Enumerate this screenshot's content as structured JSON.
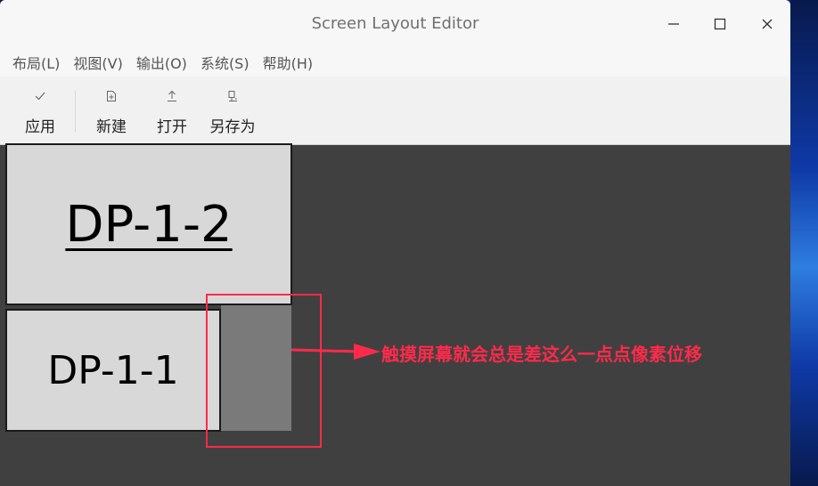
{
  "window": {
    "title": "Screen Layout Editor",
    "controls": {
      "minimize": "—",
      "maximize": "☐",
      "close": "✕"
    }
  },
  "menubar": {
    "items": [
      "布局(L)",
      "视图(V)",
      "输出(O)",
      "系统(S)",
      "帮助(H)"
    ]
  },
  "toolbar": {
    "apply": {
      "label": "应用",
      "icon": "checkmark-icon"
    },
    "new": {
      "label": "新建",
      "icon": "new-file-icon"
    },
    "open": {
      "label": "打开",
      "icon": "upload-icon"
    },
    "save_as": {
      "label": "另存为",
      "icon": "save-as-icon"
    }
  },
  "screens": [
    {
      "id": "large",
      "label": "DP-1-2",
      "selected": true
    },
    {
      "id": "small",
      "label": "DP-1-1",
      "selected": false
    }
  ],
  "annotation": {
    "text": "触摸屏幕就会总是差这么一点点像素位移",
    "color": "#ff2a4a"
  },
  "colors": {
    "canvas": "#404040",
    "screen_fill": "#d8d8d8",
    "offset_region": "#7a7a7a"
  }
}
